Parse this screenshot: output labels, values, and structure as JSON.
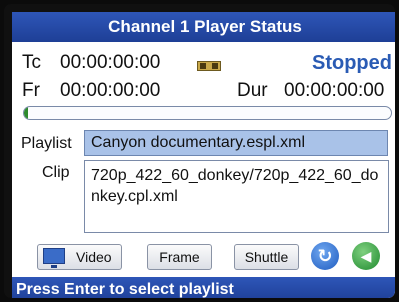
{
  "header": {
    "title": "Channel 1 Player Status"
  },
  "timecode": {
    "tc_label": "Tc",
    "tc_value": "00:00:00:00",
    "state": "Stopped",
    "fr_label": "Fr",
    "fr_value": "00:00:00:00",
    "dur_label": "Dur",
    "dur_value": "00:00:00:00"
  },
  "progress": {
    "fraction": 0.01,
    "color": "#2d8a2d"
  },
  "playlist": {
    "label": "Playlist",
    "value": "Canyon documentary.espl.xml"
  },
  "clip": {
    "label": "Clip",
    "value": "720p_422_60_donkey/720p_422_60_donkey.cpl.xml"
  },
  "buttons": {
    "video": "Video",
    "frame": "Frame",
    "shuttle": "Shuttle"
  },
  "icons": {
    "timecode_source": "tape-icon",
    "video": "monitor-icon",
    "refresh": "refresh-icon",
    "audio": "speaker-icon"
  },
  "statusbar": {
    "message": "Press Enter to select playlist"
  },
  "colors": {
    "accent": "#2a5bb4",
    "playlist_highlight": "#a9c2e8"
  }
}
